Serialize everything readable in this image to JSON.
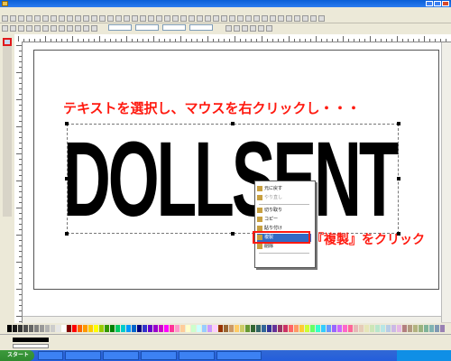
{
  "overlay": {
    "instruction": "テキストを選択し、マウスを右クリックし・・・",
    "click_note": "『複製』をクリック"
  },
  "canvas": {
    "text_object": "DOLLSENT"
  },
  "context_menu": {
    "items": [
      {
        "label": "元に戻す",
        "icon": "undo-icon",
        "state": "normal"
      },
      {
        "label": "やり直し",
        "icon": "redo-icon",
        "state": "disabled"
      },
      {
        "label": "切り取り",
        "icon": "cut-icon",
        "state": "normal"
      },
      {
        "label": "コピー",
        "icon": "copy-icon",
        "state": "normal"
      },
      {
        "label": "貼り付け",
        "icon": "paste-icon",
        "state": "normal"
      },
      {
        "label": "複製",
        "icon": "duplicate-icon",
        "state": "highlighted"
      },
      {
        "label": "削除",
        "icon": "delete-icon",
        "state": "normal"
      }
    ]
  },
  "colors": {
    "annotation": "#ff1a10",
    "highlight": "#316ac5"
  },
  "taskbar": {
    "start_label": "スタート"
  }
}
